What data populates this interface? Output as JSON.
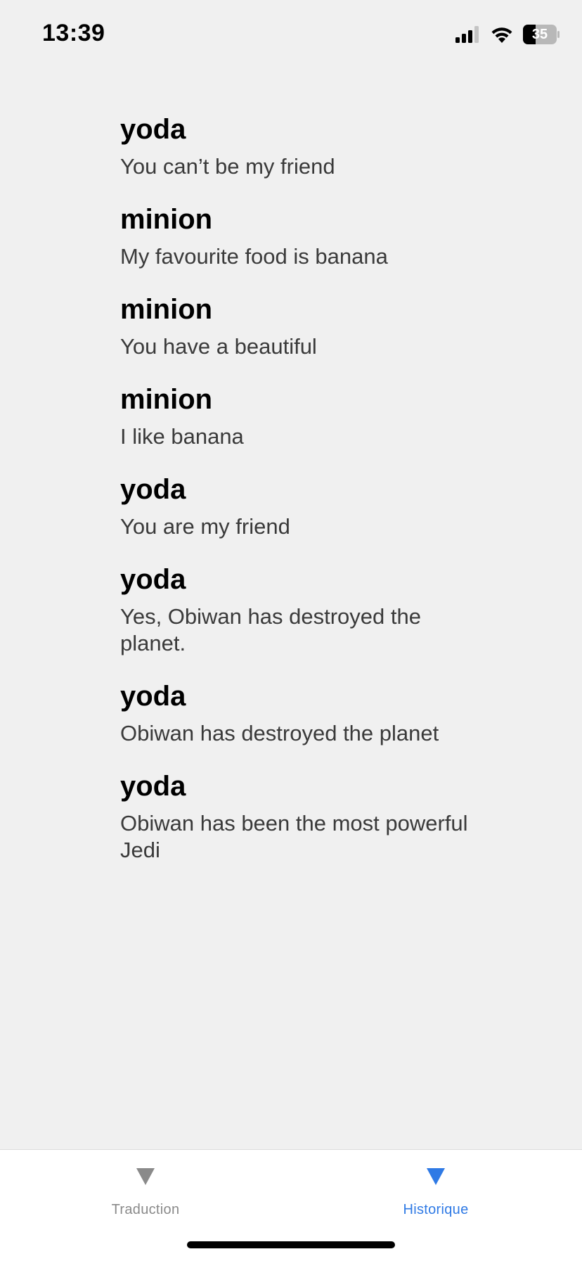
{
  "status_bar": {
    "time": "13:39",
    "battery": "35",
    "icons": [
      "cellular-signal-icon",
      "wifi-icon",
      "battery-icon"
    ]
  },
  "history": [
    {
      "character": "yoda",
      "text": "You can’t be my friend"
    },
    {
      "character": "minion",
      "text": "My favourite food is banana"
    },
    {
      "character": "minion",
      "text": "You have a beautiful"
    },
    {
      "character": "minion",
      "text": "I like banana"
    },
    {
      "character": "yoda",
      "text": "You are my friend"
    },
    {
      "character": "yoda",
      "text": "Yes, Obiwan has destroyed the planet."
    },
    {
      "character": "yoda",
      "text": "Obiwan has destroyed the planet"
    },
    {
      "character": "yoda",
      "text": "Obiwan has been the most powerful Jedi"
    }
  ],
  "tab_bar": {
    "tabs": [
      {
        "label": "Traduction",
        "icon": "triangle-down-icon",
        "active": false
      },
      {
        "label": "Historique",
        "icon": "triangle-down-icon",
        "active": true
      }
    ]
  },
  "colors": {
    "accent": "#2f7ae5",
    "inactive_tab": "#8a8a8a",
    "background": "#f0f0f0"
  }
}
